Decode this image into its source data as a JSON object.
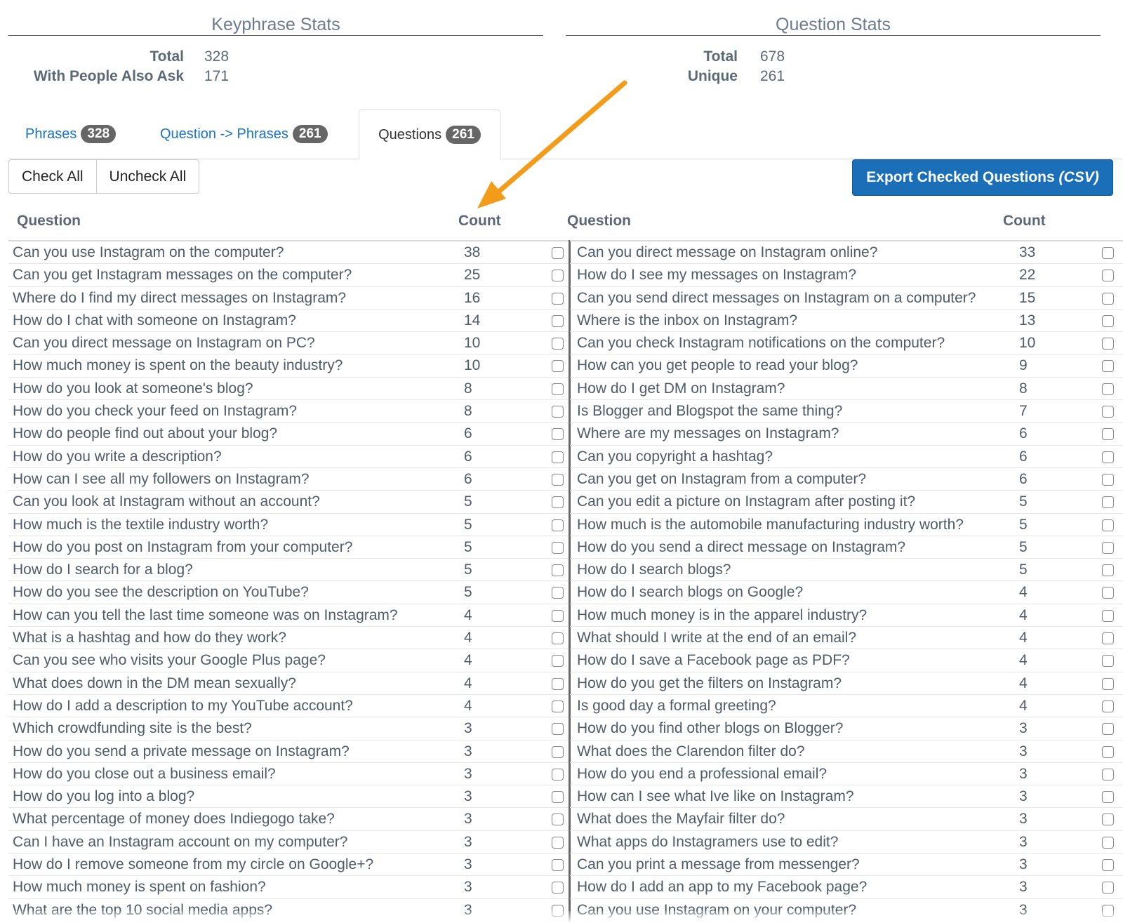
{
  "keyphrase_stats": {
    "title": "Keyphrase Stats",
    "total_label": "Total",
    "total_value": "328",
    "paa_label": "With People Also Ask",
    "paa_value": "171"
  },
  "question_stats": {
    "title": "Question Stats",
    "total_label": "Total",
    "total_value": "678",
    "unique_label": "Unique",
    "unique_value": "261"
  },
  "tabs": [
    {
      "label": "Phrases",
      "badge": "328"
    },
    {
      "label": "Question -> Phrases",
      "badge": "261"
    },
    {
      "label": "Questions",
      "badge": "261"
    }
  ],
  "toolbar": {
    "check_all": "Check All",
    "uncheck_all": "Uncheck All",
    "export_label": "Export Checked Questions ",
    "export_suffix": "(CSV)"
  },
  "table_headers": {
    "question": "Question",
    "count": "Count"
  },
  "colors": {
    "accent": "#1b6fb8",
    "arrow": "#f39c1a",
    "badge": "#666666",
    "link": "#1a73c9"
  },
  "left_rows": [
    {
      "q": "Can you use Instagram on the computer?",
      "c": "38"
    },
    {
      "q": "Can you get Instagram messages on the computer?",
      "c": "25"
    },
    {
      "q": "Where do I find my direct messages on Instagram?",
      "c": "16"
    },
    {
      "q": "How do I chat with someone on Instagram?",
      "c": "14"
    },
    {
      "q": "Can you direct message on Instagram on PC?",
      "c": "10"
    },
    {
      "q": "How much money is spent on the beauty industry?",
      "c": "10"
    },
    {
      "q": "How do you look at someone's blog?",
      "c": "8"
    },
    {
      "q": "How do you check your feed on Instagram?",
      "c": "8"
    },
    {
      "q": "How do people find out about your blog?",
      "c": "6"
    },
    {
      "q": "How do you write a description?",
      "c": "6"
    },
    {
      "q": "How can I see all my followers on Instagram?",
      "c": "6"
    },
    {
      "q": "Can you look at Instagram without an account?",
      "c": "5"
    },
    {
      "q": "How much is the textile industry worth?",
      "c": "5"
    },
    {
      "q": "How do you post on Instagram from your computer?",
      "c": "5"
    },
    {
      "q": "How do I search for a blog?",
      "c": "5"
    },
    {
      "q": "How do you see the description on YouTube?",
      "c": "5"
    },
    {
      "q": "How can you tell the last time someone was on Instagram?",
      "c": "4"
    },
    {
      "q": "What is a hashtag and how do they work?",
      "c": "4"
    },
    {
      "q": "Can you see who visits your Google Plus page?",
      "c": "4"
    },
    {
      "q": "What does down in the DM mean sexually?",
      "c": "4"
    },
    {
      "q": "How do I add a description to my YouTube account?",
      "c": "4"
    },
    {
      "q": "Which crowdfunding site is the best?",
      "c": "3"
    },
    {
      "q": "How do you send a private message on Instagram?",
      "c": "3"
    },
    {
      "q": "How do you close out a business email?",
      "c": "3"
    },
    {
      "q": "How do you log into a blog?",
      "c": "3"
    },
    {
      "q": "What percentage of money does Indiegogo take?",
      "c": "3"
    },
    {
      "q": "Can I have an Instagram account on my computer?",
      "c": "3"
    },
    {
      "q": "How do I remove someone from my circle on Google+?",
      "c": "3"
    },
    {
      "q": "How much money is spent on fashion?",
      "c": "3"
    },
    {
      "q": "What are the top 10 social media apps?",
      "c": "3"
    }
  ],
  "right_rows": [
    {
      "q": "Can you direct message on Instagram online?",
      "c": "33"
    },
    {
      "q": "How do I see my messages on Instagram?",
      "c": "22"
    },
    {
      "q": "Can you send direct messages on Instagram on a computer?",
      "c": "15"
    },
    {
      "q": "Where is the inbox on Instagram?",
      "c": "13"
    },
    {
      "q": "Can you check Instagram notifications on the computer?",
      "c": "10"
    },
    {
      "q": "How can you get people to read your blog?",
      "c": "9"
    },
    {
      "q": "How do I get DM on Instagram?",
      "c": "8"
    },
    {
      "q": "Is Blogger and Blogspot the same thing?",
      "c": "7"
    },
    {
      "q": "Where are my messages on Instagram?",
      "c": "6"
    },
    {
      "q": "Can you copyright a hashtag?",
      "c": "6"
    },
    {
      "q": "Can you get on Instagram from a computer?",
      "c": "6"
    },
    {
      "q": "Can you edit a picture on Instagram after posting it?",
      "c": "5"
    },
    {
      "q": "How much is the automobile manufacturing industry worth?",
      "c": "5"
    },
    {
      "q": "How do you send a direct message on Instagram?",
      "c": "5"
    },
    {
      "q": "How do I search blogs?",
      "c": "5"
    },
    {
      "q": "How do I search blogs on Google?",
      "c": "4"
    },
    {
      "q": "How much money is in the apparel industry?",
      "c": "4"
    },
    {
      "q": "What should I write at the end of an email?",
      "c": "4"
    },
    {
      "q": "How do I save a Facebook page as PDF?",
      "c": "4"
    },
    {
      "q": "How do you get the filters on Instagram?",
      "c": "4"
    },
    {
      "q": "Is good day a formal greeting?",
      "c": "4"
    },
    {
      "q": "How do you find other blogs on Blogger?",
      "c": "3"
    },
    {
      "q": "What does the Clarendon filter do?",
      "c": "3"
    },
    {
      "q": "How do you end a professional email?",
      "c": "3"
    },
    {
      "q": "How can I see what Ive like on Instagram?",
      "c": "3"
    },
    {
      "q": "What does the Mayfair filter do?",
      "c": "3"
    },
    {
      "q": "What apps do Instagramers use to edit?",
      "c": "3"
    },
    {
      "q": "Can you print a message from messenger?",
      "c": "3"
    },
    {
      "q": "How do I add an app to my Facebook page?",
      "c": "3"
    },
    {
      "q": "Can you use Instagram on your computer?",
      "c": "3"
    }
  ]
}
